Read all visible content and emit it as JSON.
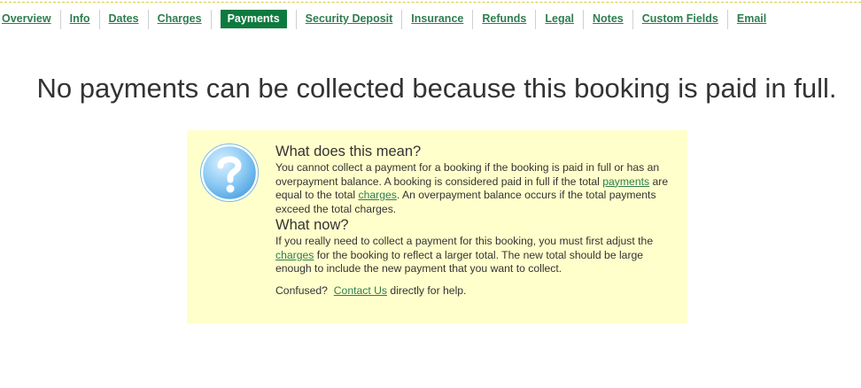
{
  "tabs": [
    {
      "label": "Overview"
    },
    {
      "label": "Info"
    },
    {
      "label": "Dates"
    },
    {
      "label": "Charges"
    },
    {
      "label": "Payments",
      "active": true
    },
    {
      "label": "Security Deposit"
    },
    {
      "label": "Insurance"
    },
    {
      "label": "Refunds"
    },
    {
      "label": "Legal"
    },
    {
      "label": "Notes"
    },
    {
      "label": "Custom Fields"
    },
    {
      "label": "Email"
    }
  ],
  "headline": "No payments can be collected because this booking is paid in full.",
  "help": {
    "icon": "question-icon",
    "section1": {
      "title": "What does this mean?",
      "text_a": "You cannot collect a payment for a booking if the booking is paid in full or has an overpayment balance.  A booking is considered paid in full if the total ",
      "link_payments": "payments",
      "text_b": " are equal to the total ",
      "link_charges": "charges",
      "text_c": ".  An overpayment balance occurs if the total payments exceed the total charges."
    },
    "section2": {
      "title": "What now?",
      "text_a": "If you really need to collect a payment for this booking, you must first adjust the ",
      "link_charges": "charges",
      "text_b": " for the booking to reflect a larger total.  The new total should be large enough to include the new payment that you want to collect."
    },
    "confused": {
      "text_a": "Confused?  ",
      "link_contact": "Contact Us",
      "text_b": " directly for help."
    }
  },
  "colors": {
    "accent": "#0f7a3f",
    "link": "#2e7d4f",
    "infobox_bg": "#ffffcc"
  }
}
